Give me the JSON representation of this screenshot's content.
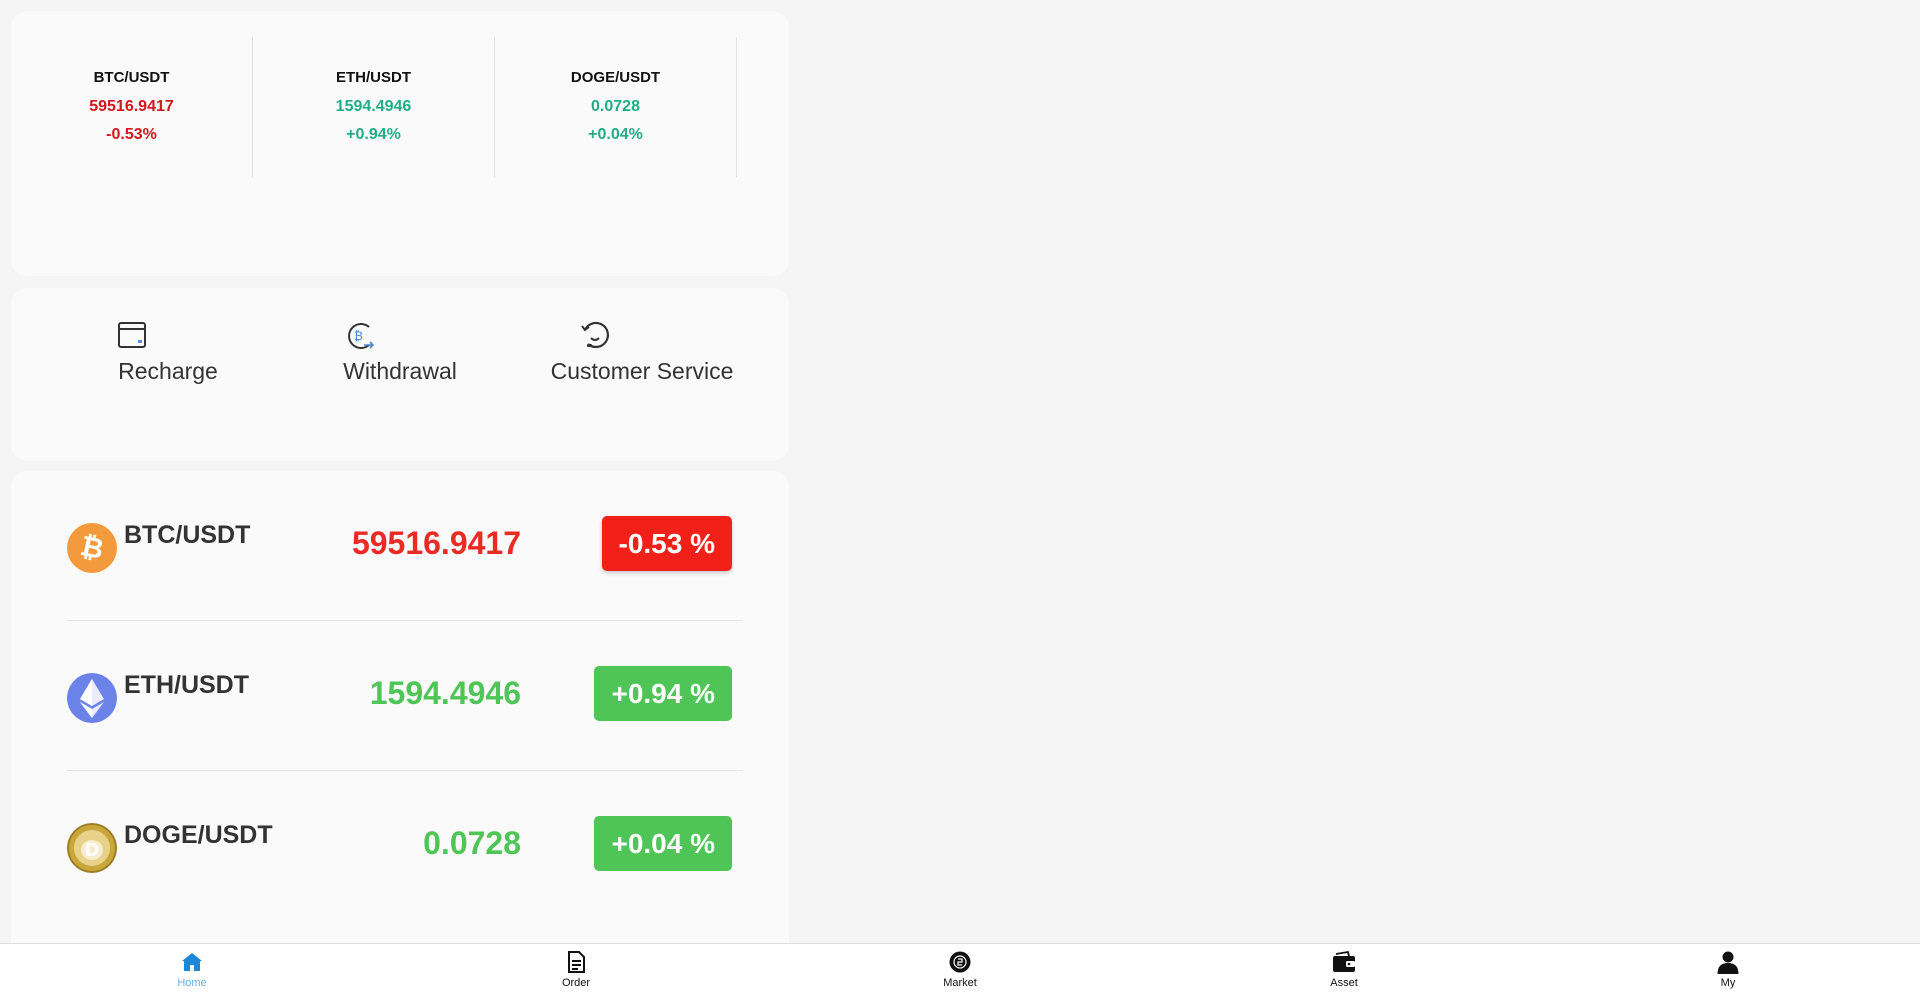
{
  "tickers": [
    {
      "pair": "BTC/USDT",
      "price": "59516.9417",
      "change": "-0.53%",
      "trend": "down"
    },
    {
      "pair": "ETH/USDT",
      "price": "1594.4946",
      "change": "+0.94%",
      "trend": "up"
    },
    {
      "pair": "DOGE/USDT",
      "price": "0.0728",
      "change": "+0.04%",
      "trend": "up"
    }
  ],
  "actions": [
    {
      "label": "Recharge",
      "icon": "wallet-card-icon"
    },
    {
      "label": "Withdrawal",
      "icon": "bitcoin-transfer-icon"
    },
    {
      "label": "Customer Service",
      "icon": "headset-icon"
    }
  ],
  "market": [
    {
      "pair": "BTC/USDT",
      "price": "59516.9417",
      "change": "-0.53 %",
      "trend": "down",
      "icon": "bitcoin-icon"
    },
    {
      "pair": "ETH/USDT",
      "price": "1594.4946",
      "change": "+0.94 %",
      "trend": "up",
      "icon": "ethereum-icon"
    },
    {
      "pair": "DOGE/USDT",
      "price": "0.0728",
      "change": "+0.04 %",
      "trend": "up",
      "icon": "dogecoin-icon"
    }
  ],
  "tabs": [
    {
      "label": "Home",
      "icon": "home-icon",
      "active": true
    },
    {
      "label": "Order",
      "icon": "document-icon",
      "active": false
    },
    {
      "label": "Market",
      "icon": "market-icon",
      "active": false
    },
    {
      "label": "Asset",
      "icon": "wallet-icon",
      "active": false
    },
    {
      "label": "My",
      "icon": "user-icon",
      "active": false
    }
  ],
  "colors": {
    "down": "#d4161e",
    "up": "#1fae87",
    "badge_down": "#f1211a",
    "badge_up": "#4ec556",
    "tab_active": "#6aaee6"
  }
}
